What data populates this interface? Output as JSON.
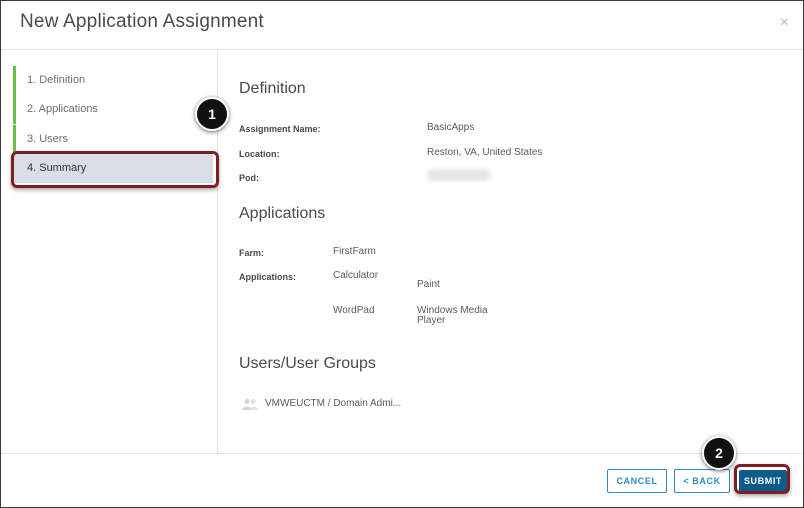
{
  "dialog": {
    "title": "New Application Assignment",
    "close_glyph": "×"
  },
  "steps": [
    {
      "label": "1. Definition",
      "active": false
    },
    {
      "label": "2. Applications",
      "active": false
    },
    {
      "label": "3. Users",
      "active": false
    },
    {
      "label": "4. Summary",
      "active": true
    }
  ],
  "definition": {
    "heading": "Definition",
    "assignment_name_label": "Assignment Name:",
    "assignment_name_value": "BasicApps",
    "location_label": "Location:",
    "location_value": "Reston, VA, United States",
    "pod_label": "Pod:"
  },
  "applications": {
    "heading": "Applications",
    "farm_label": "Farm:",
    "farm_value": "FirstFarm",
    "applications_label": "Applications:",
    "items": [
      "Calculator",
      "Paint",
      "WordPad",
      "Windows Media",
      "Player"
    ]
  },
  "users": {
    "heading": "Users/User Groups",
    "entry": "VMWEUCTM / Domain Admi..."
  },
  "footer": {
    "cancel_label": "CANCEL",
    "back_label": "< BACK",
    "submit_label": "SUBMIT"
  },
  "callouts": [
    "1",
    "2"
  ],
  "colors": {
    "accent_green": "#6cc04a",
    "primary_blue": "#0b5c8c",
    "outline_blue": "#2d8ac7",
    "highlight": "#7d1f22"
  }
}
